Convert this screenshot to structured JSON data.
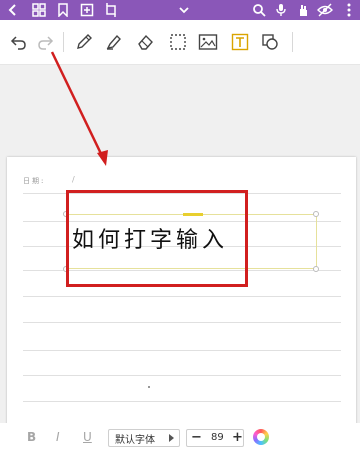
{
  "colors": {
    "topbar": "#8a57b8",
    "annotation_red": "#d11f1f",
    "textbox_border": "#e6e19b",
    "textbox_handle": "#e8cf2f",
    "text_tool_accent": "#d9a400"
  },
  "topbar": {
    "icons": [
      "back-icon",
      "grid-icon",
      "bookmark-icon",
      "add-page-icon",
      "crop-icon",
      "chevron-down-icon",
      "search-icon",
      "microphone-icon",
      "hand-icon",
      "eye-off-icon",
      "more-icon"
    ]
  },
  "toolbar": {
    "tools": [
      "undo-icon",
      "redo-icon",
      "pen-icon",
      "highlighter-icon",
      "eraser-icon",
      "lasso-select-icon",
      "image-icon",
      "text-icon",
      "shapes-icon"
    ],
    "active_tool": "text-icon"
  },
  "page": {
    "date_label": "日期:",
    "date_separator": "/"
  },
  "textbox": {
    "content": "如何打字输入"
  },
  "formatbar": {
    "bold_label": "B",
    "italic_label": "I",
    "underline_label": "U",
    "font_name": "默认字体",
    "font_size": "89",
    "minus_label": "−",
    "plus_label": "+"
  }
}
